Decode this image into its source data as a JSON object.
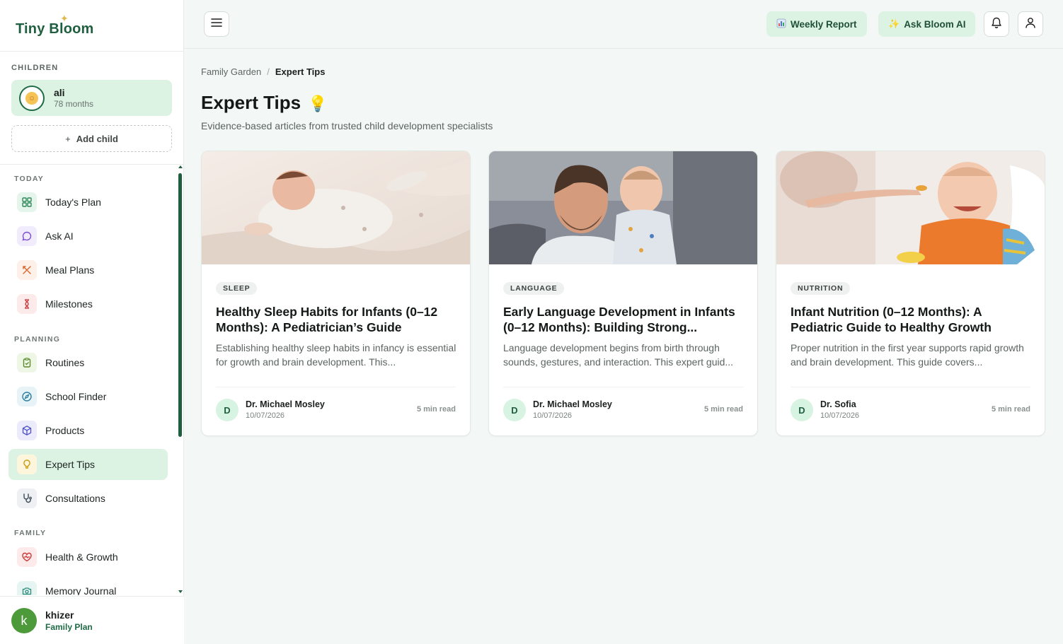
{
  "app": {
    "logo_text": "Tiny Bloom"
  },
  "children": {
    "section_label": "CHILDREN",
    "child": {
      "name": "ali",
      "age": "78 months"
    },
    "add_child_label": "Add child"
  },
  "sidebar": {
    "sections": {
      "today": "TODAY",
      "planning": "PLANNING",
      "family": "FAMILY"
    },
    "items": [
      {
        "label": "Today's Plan",
        "icon": "grid-icon"
      },
      {
        "label": "Ask AI",
        "icon": "chat-icon"
      },
      {
        "label": "Meal Plans",
        "icon": "utensils-icon"
      },
      {
        "label": "Milestones",
        "icon": "milestone-icon"
      },
      {
        "label": "Routines",
        "icon": "clipboard-icon"
      },
      {
        "label": "School Finder",
        "icon": "compass-icon"
      },
      {
        "label": "Products",
        "icon": "box-icon"
      },
      {
        "label": "Expert Tips",
        "icon": "lightbulb-icon",
        "active": true
      },
      {
        "label": "Consultations",
        "icon": "stethoscope-icon"
      },
      {
        "label": "Health & Growth",
        "icon": "heart-pulse-icon"
      },
      {
        "label": "Memory Journal",
        "icon": "camera-icon"
      }
    ]
  },
  "user": {
    "initial": "k",
    "name": "khizer",
    "plan": "Family Plan"
  },
  "topbar": {
    "weekly_report": "Weekly Report",
    "ask_bloom": "Ask Bloom AI"
  },
  "breadcrumb": {
    "parent": "Family Garden",
    "current": "Expert Tips"
  },
  "page": {
    "title": "Expert Tips",
    "subtitle": "Evidence-based articles from trusted child development specialists"
  },
  "articles": [
    {
      "tag": "SLEEP",
      "title": "Healthy Sleep Habits for Infants (0–12 Months): A Pediatrician’s Guide",
      "desc": "Establishing healthy sleep habits in infancy is essential for growth and brain development. This...",
      "author_initial": "D",
      "author": "Dr. Michael Mosley",
      "date": "10/07/2026",
      "read_time": "5 min read"
    },
    {
      "tag": "LANGUAGE",
      "title": "Early Language Development in Infants (0–12 Months): Building Strong...",
      "desc": "Language development begins from birth through sounds, gestures, and interaction. This expert guid...",
      "author_initial": "D",
      "author": "Dr. Michael Mosley",
      "date": "10/07/2026",
      "read_time": "5 min read"
    },
    {
      "tag": "NUTRITION",
      "title": "Infant Nutrition (0–12 Months): A Pediatric Guide to Healthy Growth",
      "desc": "Proper nutrition in the first year supports rapid growth and brain development. This guide covers...",
      "author_initial": "D",
      "author": "Dr. Sofia",
      "date": "10/07/2026",
      "read_time": "5 min read"
    }
  ],
  "colors": {
    "brand": "#1f5f3f",
    "accent_bg": "#dcf3e4"
  }
}
